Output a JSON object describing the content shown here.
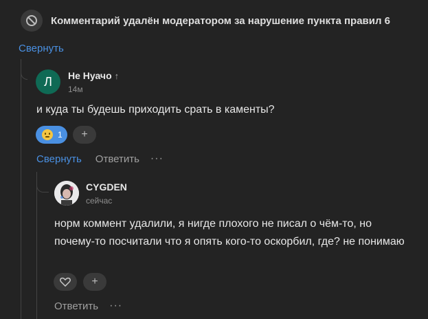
{
  "deleted_comment": {
    "icon": "ban-icon",
    "text": "Комментарий удалён модератором за нарушение пункта правил 6"
  },
  "collapse_top_label": "Свернуть",
  "comment1": {
    "avatar_letter": "Л",
    "avatar_color": "#0f6a55",
    "author": "Не Нуачо",
    "author_arrow": "↑",
    "time": "14м",
    "text": "и куда ты будешь приходить срать в каменты?",
    "reaction": {
      "icon": "neutral-face-emoji-icon",
      "count": "1",
      "color": "#4a90e2"
    },
    "add_reaction_icon": "plus-icon",
    "add_reaction_label": "+",
    "collapse_label": "Свернуть",
    "reply_label": "Ответить",
    "more_label": "···"
  },
  "comment2": {
    "author": "CYGDEN",
    "time": "сейчас",
    "text": "норм коммент удалили, я нигде плохого не писал о чём-то, но почему-то посчитали что я опять кого-то оскорбил, где? не понимаю",
    "like_icon": "heart-icon",
    "add_reaction_icon": "plus-icon",
    "add_reaction_label": "+",
    "reply_label": "Ответить",
    "more_label": "···"
  },
  "colors": {
    "background": "#232323",
    "link": "#4a90e2",
    "muted": "#8f8f8f"
  }
}
